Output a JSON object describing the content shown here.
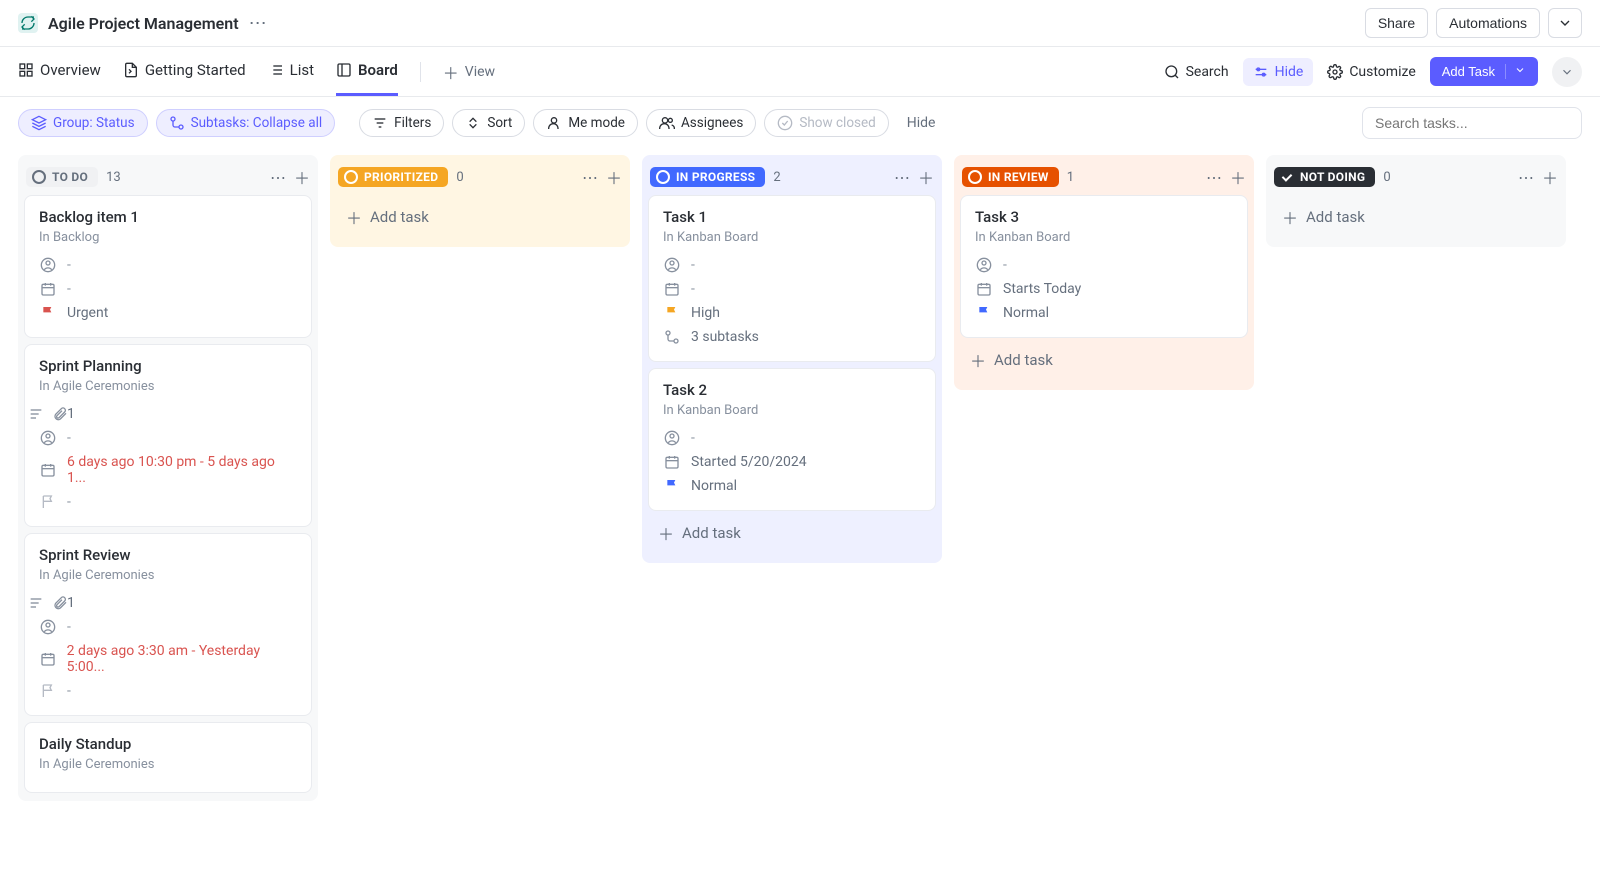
{
  "header": {
    "title": "Agile Project Management",
    "share": "Share",
    "automations": "Automations"
  },
  "tabs": {
    "overview": "Overview",
    "getting_started": "Getting Started",
    "list": "List",
    "board": "Board",
    "view": "View",
    "search": "Search",
    "hide": "Hide",
    "customize": "Customize",
    "add_task": "Add Task"
  },
  "filters": {
    "group": "Group: Status",
    "subtasks": "Subtasks: Collapse all",
    "filters": "Filters",
    "sort": "Sort",
    "me_mode": "Me mode",
    "assignees": "Assignees",
    "show_closed": "Show closed",
    "hide": "Hide",
    "search_placeholder": "Search tasks..."
  },
  "columns": [
    {
      "id": "todo",
      "label": "TO DO",
      "count": "13",
      "pill_bg": "#f0f1f3",
      "pill_color": "#656f7d",
      "wrap_class": "col-bg-gray",
      "indicator": "circle",
      "show_add_bottom": false,
      "cards": [
        {
          "title": "Backlog item 1",
          "sub": "In Backlog",
          "rows": [
            {
              "icon": "user",
              "text": "-",
              "class": "muted"
            },
            {
              "icon": "calendar",
              "text": "-",
              "class": "muted"
            },
            {
              "icon": "flag-red",
              "text": "Urgent",
              "class": ""
            }
          ]
        },
        {
          "title": "Sprint Planning",
          "sub": "In Agile Ceremonies",
          "rows": [
            {
              "icon": "desc-attach",
              "text": "1",
              "class": ""
            },
            {
              "icon": "user",
              "text": "-",
              "class": "muted"
            },
            {
              "icon": "calendar",
              "text": "6 days ago 10:30 pm - 5 days ago 1...",
              "class": "overdue"
            },
            {
              "icon": "flag-gray",
              "text": "-",
              "class": "muted"
            }
          ]
        },
        {
          "title": "Sprint Review",
          "sub": "In Agile Ceremonies",
          "rows": [
            {
              "icon": "desc-attach",
              "text": "1",
              "class": ""
            },
            {
              "icon": "user",
              "text": "-",
              "class": "muted"
            },
            {
              "icon": "calendar",
              "text": "2 days ago 3:30 am - Yesterday 5:00...",
              "class": "overdue"
            },
            {
              "icon": "flag-gray",
              "text": "-",
              "class": "muted"
            }
          ]
        },
        {
          "title": "Daily Standup",
          "sub": "In Agile Ceremonies",
          "rows": []
        }
      ]
    },
    {
      "id": "prioritized",
      "label": "PRIORITIZED",
      "count": "0",
      "pill_bg": "#f5a623",
      "pill_color": "#ffffff",
      "wrap_class": "col-bg-orange",
      "indicator": "circle",
      "show_add_bottom": true,
      "cards": []
    },
    {
      "id": "inprogress",
      "label": "IN PROGRESS",
      "count": "2",
      "pill_bg": "#4169ff",
      "pill_color": "#ffffff",
      "wrap_class": "col-bg-blue",
      "indicator": "circle",
      "show_add_bottom": true,
      "cards": [
        {
          "title": "Task 1",
          "sub": "In Kanban Board",
          "rows": [
            {
              "icon": "user",
              "text": "-",
              "class": "muted"
            },
            {
              "icon": "calendar",
              "text": "-",
              "class": "muted"
            },
            {
              "icon": "flag-yellow",
              "text": "High",
              "class": ""
            },
            {
              "icon": "subtask",
              "text": "3 subtasks",
              "class": ""
            }
          ]
        },
        {
          "title": "Task 2",
          "sub": "In Kanban Board",
          "rows": [
            {
              "icon": "user",
              "text": "-",
              "class": "muted"
            },
            {
              "icon": "calendar",
              "text": "Started 5/20/2024",
              "class": ""
            },
            {
              "icon": "flag-blue",
              "text": "Normal",
              "class": ""
            }
          ]
        }
      ]
    },
    {
      "id": "inreview",
      "label": "IN REVIEW",
      "count": "1",
      "pill_bg": "#e65100",
      "pill_color": "#ffffff",
      "wrap_class": "col-bg-orange2",
      "indicator": "circle",
      "show_add_bottom": true,
      "cards": [
        {
          "title": "Task 3",
          "sub": "In Kanban Board",
          "rows": [
            {
              "icon": "user",
              "text": "-",
              "class": "muted"
            },
            {
              "icon": "calendar",
              "text": "Starts Today",
              "class": ""
            },
            {
              "icon": "flag-blue",
              "text": "Normal",
              "class": ""
            }
          ]
        }
      ]
    },
    {
      "id": "notdoing",
      "label": "NOT DOING",
      "count": "0",
      "pill_bg": "#2a2e34",
      "pill_color": "#ffffff",
      "wrap_class": "col-bg-gray",
      "indicator": "check",
      "show_add_bottom": true,
      "cards": []
    }
  ],
  "add_task_label": "Add task"
}
